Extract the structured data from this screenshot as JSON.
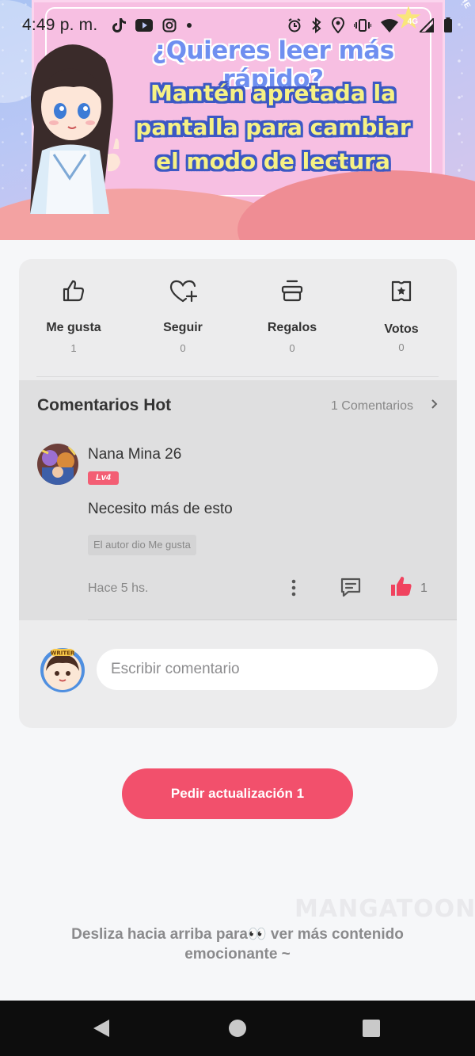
{
  "status_bar": {
    "time": "4:49 p. m.",
    "network": "4G"
  },
  "banner": {
    "headline": "¿Quieres leer más rápido?",
    "subline_1": "Mantén apretada la",
    "subline_2": "pantalla para cambiar",
    "subline_3": "el modo de lectura",
    "corner_text": "OR YOU! THE"
  },
  "stats": [
    {
      "label": "Me gusta",
      "value": "1",
      "icon": "thumbs-up-icon"
    },
    {
      "label": "Seguir",
      "value": "0",
      "icon": "heart-plus-icon"
    },
    {
      "label": "Regalos",
      "value": "0",
      "icon": "gift-icon"
    },
    {
      "label": "Votos",
      "value": "0",
      "icon": "vote-ticket-icon"
    }
  ],
  "hot_comments": {
    "title": "Comentarios Hot",
    "count_label": "1 Comentarios",
    "comment": {
      "username": "Nana Mina 26",
      "level": "Lv4",
      "text": "Necesito más de esto",
      "author_liked": "El autor dio Me gusta",
      "time": "Hace 5 hs.",
      "likes": "1"
    }
  },
  "composer": {
    "placeholder": "Escribir comentario",
    "avatar_badge": "WRITER"
  },
  "request_button": {
    "label": "Pedir actualización 1"
  },
  "watermark": "MANGATOON",
  "hint": {
    "line1": "Desliza hacia arriba para👀 ver más contenido",
    "line2": "emocionante ~"
  },
  "colors": {
    "accent": "#f2506c",
    "like_red": "#f0435f",
    "level_badge": "#f35e74",
    "banner_pink": "#f7bfe2",
    "subline_yellow": "#f6f184"
  }
}
